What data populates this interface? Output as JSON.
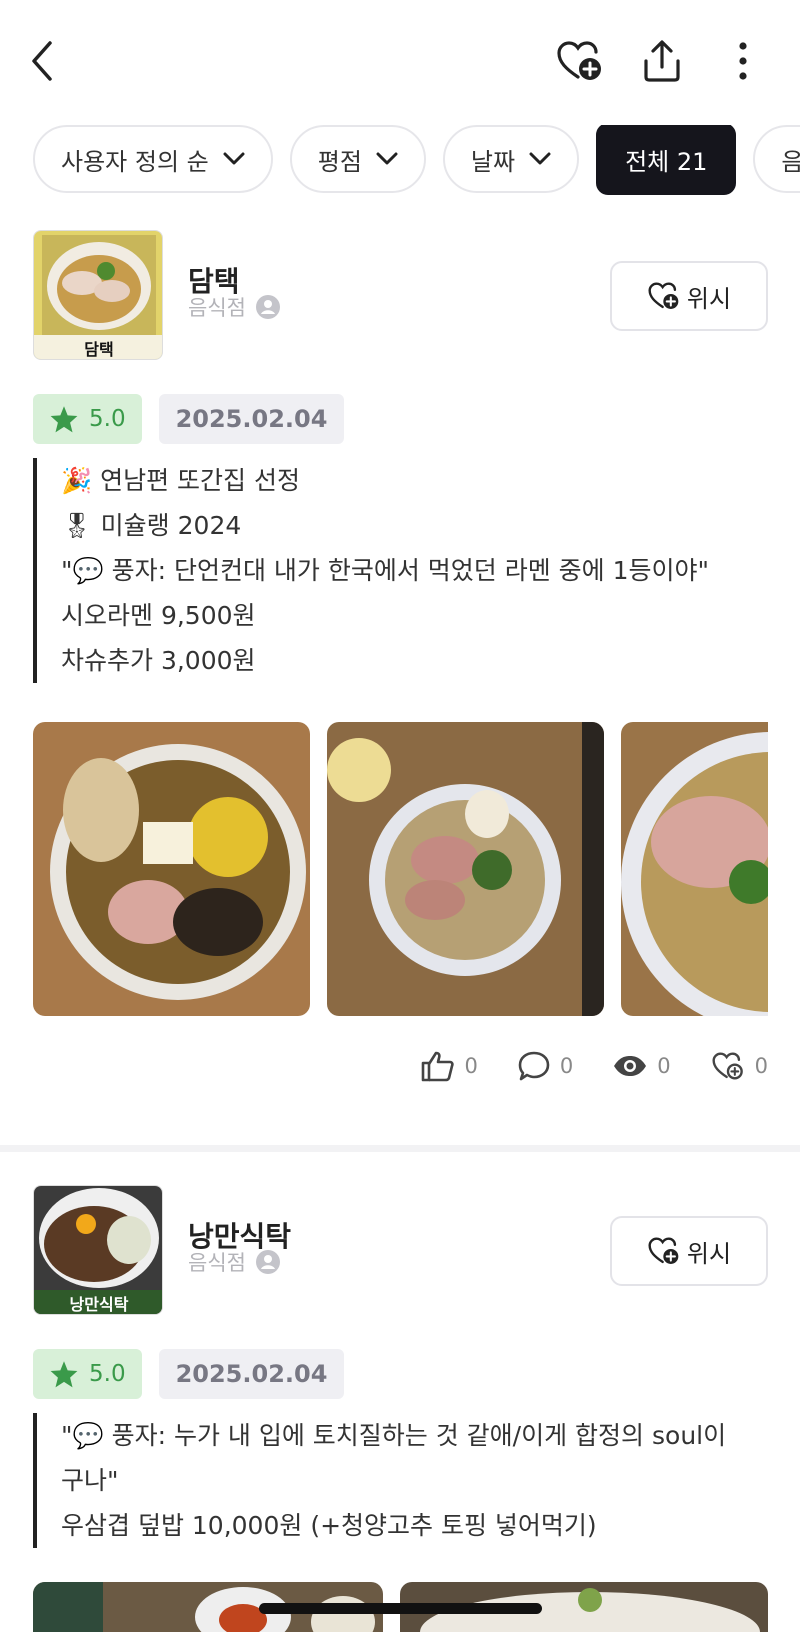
{
  "header": {
    "back_icon": "chevron-left-icon",
    "actions": [
      "heart-plus-icon",
      "share-icon",
      "more-vertical-icon"
    ]
  },
  "filters": {
    "sort": "사용자 정의 순",
    "rating": "평점",
    "date": "날짜",
    "all": "전체 21",
    "partial": "음"
  },
  "cards": [
    {
      "name": "담택",
      "category": "음식점",
      "thumb_label": "담택",
      "wish_label": "위시",
      "rating": "5.0",
      "date": "2025.02.04",
      "memo": [
        "🎉 연남편 또간집 선정",
        "🎖 미슐랭 2024",
        " \"💬 풍자: 단언컨대 내가 한국에서 먹었던 라멘 중에 1등이야\"",
        "시오라멘 9,500원",
        "차슈추가 3,000원"
      ],
      "stats": {
        "likes": "0",
        "comments": "0",
        "views": "0",
        "wishes": "0"
      }
    },
    {
      "name": "낭만식탁",
      "category": "음식점",
      "thumb_label": "낭만식탁",
      "wish_label": "위시",
      "rating": "5.0",
      "date": "2025.02.04",
      "memo": [
        "\"💬 풍자: 누가 내 입에 토치질하는 것 같애/이게 합정의 soul이",
        "구나\"",
        "우삼겹 덮밥 10,000원 (+청양고추 토핑 넣어먹기)"
      ]
    }
  ],
  "colors": {
    "accent_dark": "#15151c",
    "rating_bg": "#d8f0d8",
    "rating_fg": "#3a9a4a",
    "date_bg": "#efeff3"
  }
}
